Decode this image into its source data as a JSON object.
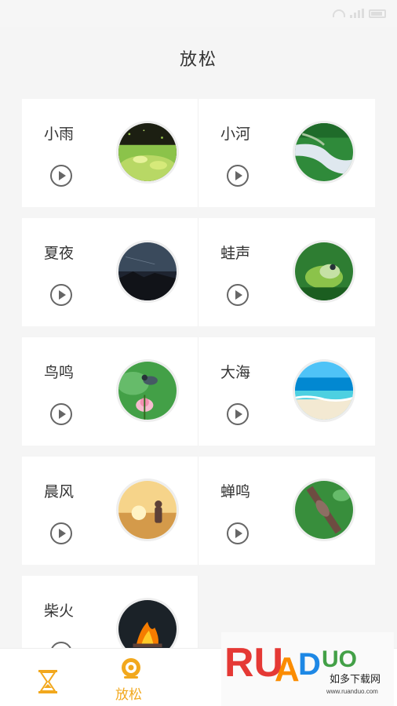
{
  "page": {
    "title": "放松"
  },
  "sounds": [
    {
      "label": "小雨",
      "icon": "play-icon",
      "image": "rain-grass-thumbnail"
    },
    {
      "label": "小河",
      "icon": "play-icon",
      "image": "river-thumbnail"
    },
    {
      "label": "夏夜",
      "icon": "play-icon",
      "image": "summer-night-thumbnail"
    },
    {
      "label": "蛙声",
      "icon": "play-icon",
      "image": "frog-thumbnail"
    },
    {
      "label": "鸟鸣",
      "icon": "play-icon",
      "image": "bird-lotus-thumbnail"
    },
    {
      "label": "大海",
      "icon": "play-icon",
      "image": "sea-thumbnail"
    },
    {
      "label": "晨风",
      "icon": "play-icon",
      "image": "morning-sun-thumbnail"
    },
    {
      "label": "蝉鸣",
      "icon": "play-icon",
      "image": "cicada-thumbnail"
    },
    {
      "label": "柴火",
      "icon": "play-icon",
      "image": "campfire-thumbnail"
    }
  ],
  "tabbar": {
    "tabs": [
      {
        "icon": "hourglass-icon"
      },
      {
        "label": "放松",
        "icon": "relax-icon",
        "active": true
      }
    ]
  },
  "watermark": {
    "brand": "RUANDUO",
    "caption": "如多下载网",
    "url": "www.ruanduo.com"
  },
  "colors": {
    "accent": "#f2a81d",
    "background": "#f5f5f5",
    "card": "#ffffff"
  }
}
